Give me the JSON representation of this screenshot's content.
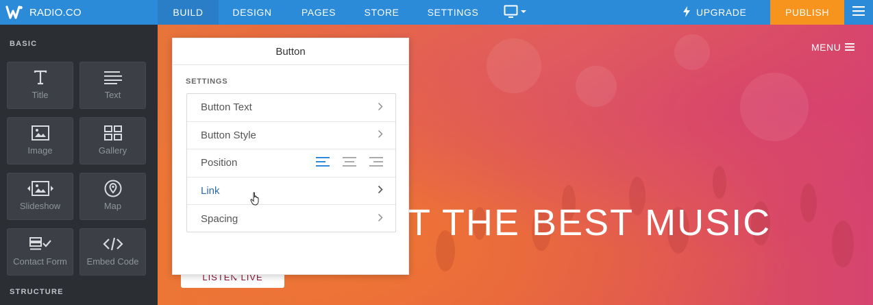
{
  "brand": {
    "name": "RADIO.CO",
    "logo_icon": "weebly-w-icon"
  },
  "topnav": {
    "items": [
      {
        "label": "BUILD",
        "active": true
      },
      {
        "label": "DESIGN"
      },
      {
        "label": "PAGES"
      },
      {
        "label": "STORE"
      },
      {
        "label": "SETTINGS"
      }
    ],
    "device_icon": "desktop-monitor-icon",
    "upgrade_label": "UPGRADE",
    "publish_label": "PUBLISH"
  },
  "sidebar": {
    "section_basic": "BASIC",
    "section_structure": "STRUCTURE",
    "elements": [
      {
        "label": "Title",
        "icon": "title-T-icon"
      },
      {
        "label": "Text",
        "icon": "text-lines-icon"
      },
      {
        "label": "Image",
        "icon": "image-icon"
      },
      {
        "label": "Gallery",
        "icon": "gallery-grid-icon"
      },
      {
        "label": "Slideshow",
        "icon": "slideshow-icon"
      },
      {
        "label": "Map",
        "icon": "map-pin-icon"
      },
      {
        "label": "Contact Form",
        "icon": "contact-form-icon"
      },
      {
        "label": "Embed Code",
        "icon": "embed-code-icon"
      }
    ]
  },
  "canvas": {
    "menu_label": "MENU",
    "hero_text": "T THE BEST MUSIC",
    "button_label": "LISTEN LIVE"
  },
  "panel": {
    "title": "Button",
    "settings_label": "SETTINGS",
    "rows": [
      {
        "label": "Button Text"
      },
      {
        "label": "Button Style"
      },
      {
        "label": "Position"
      },
      {
        "label": "Link"
      },
      {
        "label": "Spacing"
      }
    ],
    "position_active": "left"
  },
  "colors": {
    "topbar": "#2b8bd9",
    "publish": "#f7941d",
    "sidebar": "#2b2e33",
    "link": "#2b6aa8",
    "align_active": "#2b8bd9"
  }
}
